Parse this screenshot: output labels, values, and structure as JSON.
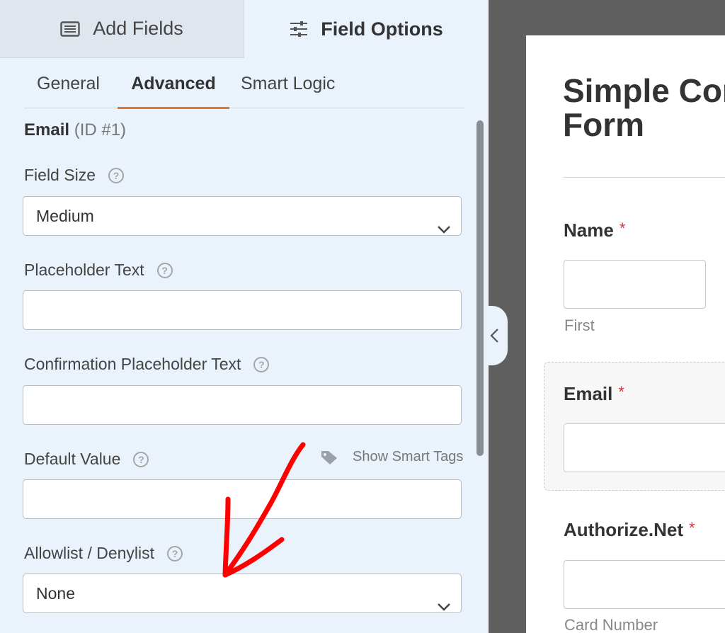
{
  "top_tabs": {
    "add_fields": "Add Fields",
    "field_options": "Field Options"
  },
  "sub_tabs": {
    "general": "General",
    "advanced": "Advanced",
    "smart_logic": "Smart Logic"
  },
  "field": {
    "name": "Email",
    "id_label": "(ID #1)"
  },
  "options": {
    "field_size_label": "Field Size",
    "field_size_value": "Medium",
    "placeholder_label": "Placeholder Text",
    "placeholder_value": "",
    "confirm_placeholder_label": "Confirmation Placeholder Text",
    "confirm_placeholder_value": "",
    "default_value_label": "Default Value",
    "default_value_value": "",
    "show_smart_tags": "Show Smart Tags",
    "allowlist_label": "Allowlist / Denylist",
    "allowlist_value": "None"
  },
  "preview": {
    "form_title": "Simple Contact\nForm",
    "name_label": "Name",
    "name_sub_first": "First",
    "email_label": "Email",
    "authorize_label": "Authorize.Net",
    "card_number": "Card Number",
    "required_mark": "*"
  },
  "colors": {
    "accent": "#e27730",
    "required": "#d63638",
    "annotation_arrow": "#ff0000"
  }
}
